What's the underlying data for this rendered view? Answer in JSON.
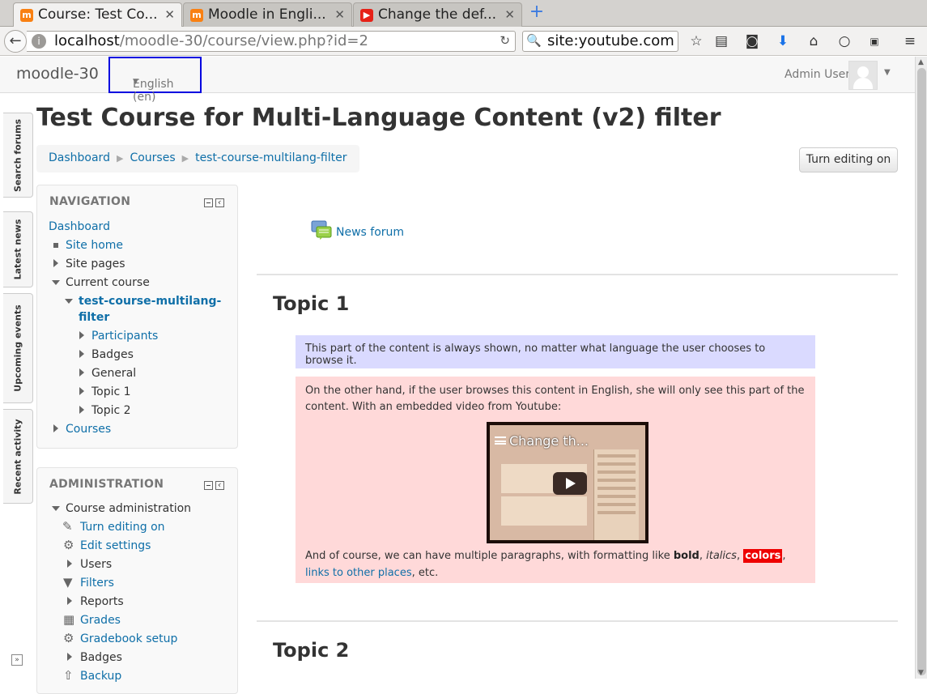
{
  "browser": {
    "tabs": [
      {
        "title": "Course: Test Co...",
        "favicon": "moodle-icon"
      },
      {
        "title": "Moodle in Engli...",
        "favicon": "moodle-icon"
      },
      {
        "title": "Change the def...",
        "favicon": "youtube-icon"
      }
    ],
    "url_host": "localhost",
    "url_path": "/moodle-30/course/view.php?id=2",
    "search_text": "site:youtube.com"
  },
  "header": {
    "brand": "moodle-30",
    "language": "English (en)",
    "user": "Admin User"
  },
  "dock": [
    "Search forums",
    "Latest news",
    "Upcoming events",
    "Recent activity"
  ],
  "page": {
    "title": "Test Course for Multi-Language Content (v2) filter",
    "breadcrumb": [
      "Dashboard",
      "Courses",
      "test-course-multilang-filter"
    ],
    "edit_button": "Turn editing on"
  },
  "navigation": {
    "title": "NAVIGATION",
    "dashboard": "Dashboard",
    "site_home": "Site home",
    "site_pages": "Site pages",
    "current_course": "Current course",
    "course_name_line1": "test-course-multilang-",
    "course_name_line2": "filter",
    "participants": "Participants",
    "badges": "Badges",
    "general": "General",
    "topic1": "Topic 1",
    "topic2": "Topic 2",
    "courses": "Courses"
  },
  "administration": {
    "title": "ADMINISTRATION",
    "course_admin": "Course administration",
    "turn_editing_on": "Turn editing on",
    "edit_settings": "Edit settings",
    "users": "Users",
    "filters": "Filters",
    "reports": "Reports",
    "grades": "Grades",
    "gradebook_setup": "Gradebook setup",
    "badges": "Badges",
    "backup": "Backup"
  },
  "content": {
    "news_forum": "News forum",
    "topic1_title": "Topic 1",
    "always_shown": "This part of the content is always shown, no matter what language the user chooses to browse it.",
    "english_only": "On the other hand, if the user browses this content in English, she will only see this part of the content. With an embedded video from Youtube:",
    "video_title": "Change th...",
    "para_start": "And of course, we can have multiple paragraphs, with formatting like ",
    "bold": "bold",
    "comma1": ", ",
    "italics": "italics",
    "comma2": ", ",
    "colors": "colors",
    "comma3": ", ",
    "link": "links to other places",
    "para_end": ", etc.",
    "topic2_title": "Topic 2"
  }
}
